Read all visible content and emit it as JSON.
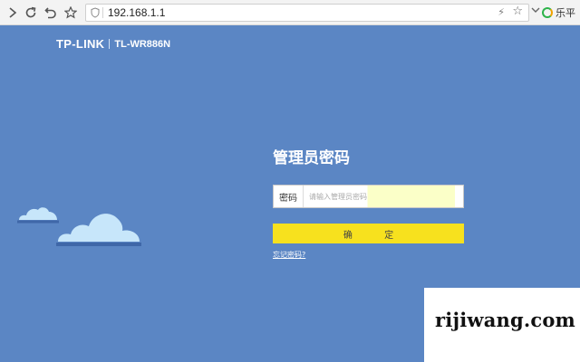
{
  "browser": {
    "url": "192.168.1.1",
    "extension_label": "乐平",
    "icons": [
      "forward-icon",
      "reload-icon",
      "undo-icon",
      "star-icon",
      "shield-icon",
      "lightning-icon",
      "chevron-down-icon",
      "leping-icon"
    ]
  },
  "page": {
    "brand": "TP-LINK",
    "model": "TL-WR886N",
    "title": "管理员密码",
    "password_label": "密码",
    "password_placeholder": "请输入管理员密码",
    "confirm_label": "确 定",
    "forgot_link": "忘记密码?",
    "watermark": "rijiwang.com"
  },
  "colors": {
    "background": "#5b86c4",
    "button": "#f7e11e",
    "cloud": "#c7e6fa",
    "cloud_shadow": "#3f67a8"
  }
}
